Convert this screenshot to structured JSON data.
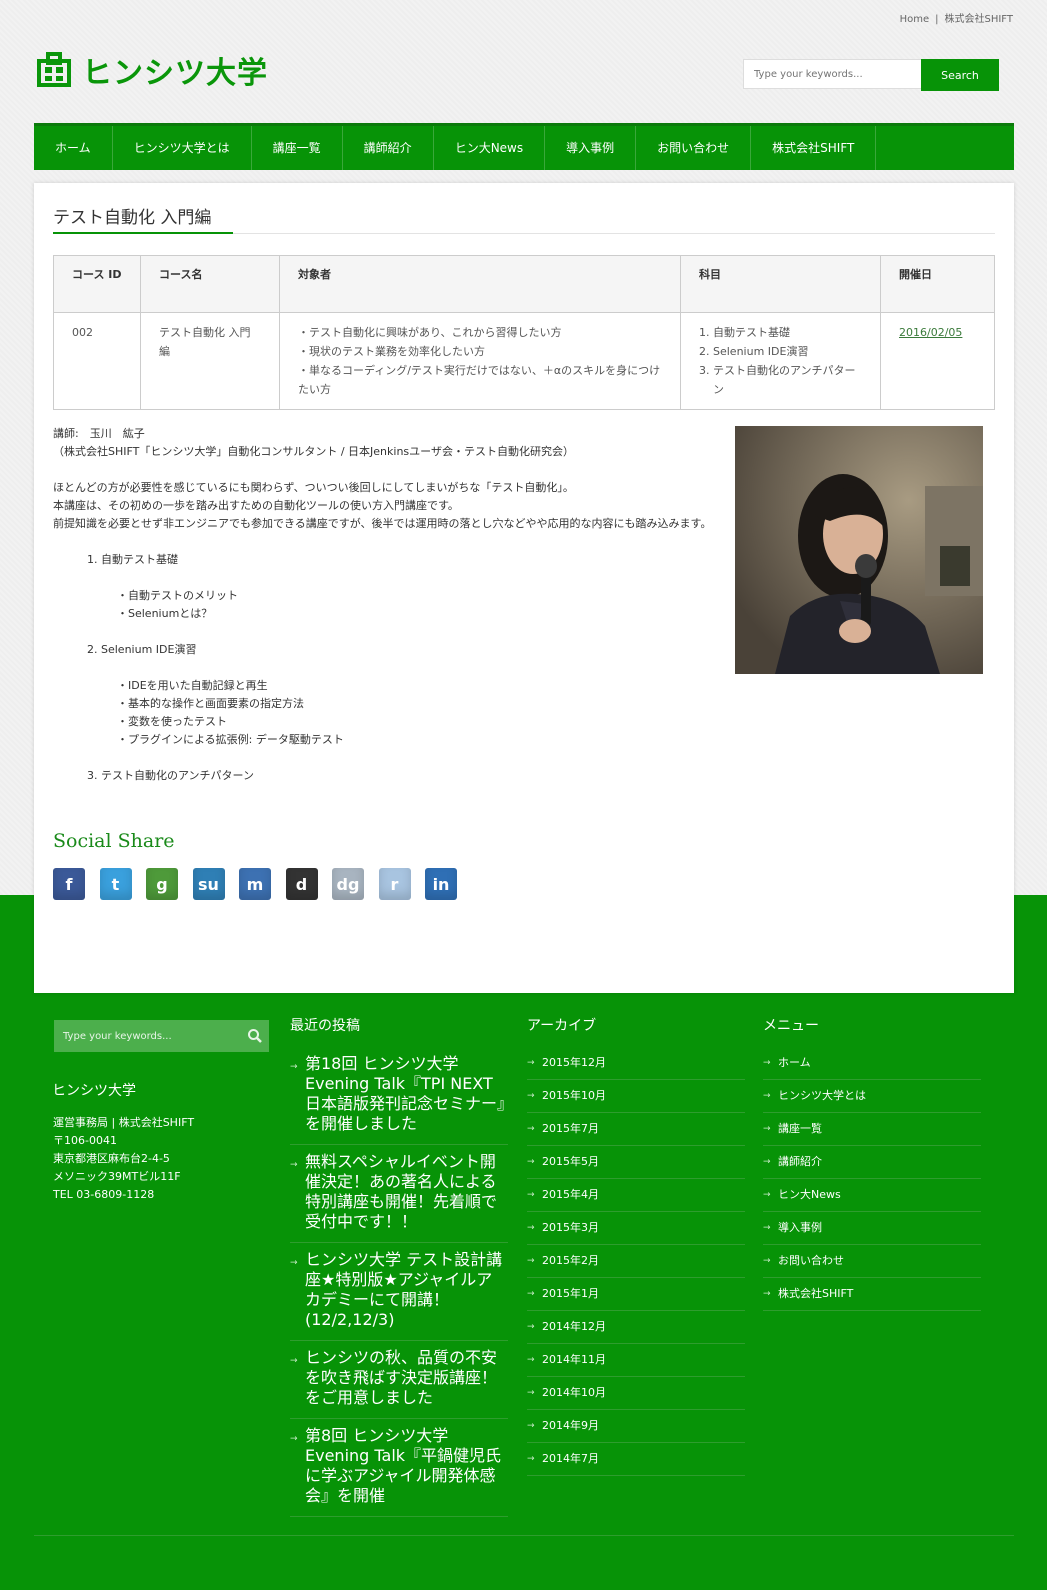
{
  "topbar": {
    "home": "Home",
    "sep": "|",
    "company": "株式会社SHIFT"
  },
  "site": {
    "title": "ヒンシツ大学",
    "brand_color": "#079307"
  },
  "search": {
    "placeholder": "Type your keywords...",
    "button": "Search"
  },
  "nav": [
    "ホーム",
    "ヒンシツ大学とは",
    "講座一覧",
    "講師紹介",
    "ヒン大News",
    "導入事例",
    "お問い合わせ",
    "株式会社SHIFT"
  ],
  "page": {
    "title": "テスト自動化 入門編"
  },
  "table": {
    "headers": [
      "コース ID",
      "コース名",
      "対象者",
      "科目",
      "開催日"
    ],
    "row": {
      "id": "002",
      "name": "テスト自動化 入門編",
      "target": [
        "・テスト自動化に興味があり、これから習得したい方",
        "・現状のテスト業務を効率化したい方",
        "・単なるコーディング/テスト実行だけではない、＋αのスキルを身につけたい方"
      ],
      "subjects": [
        "自動テスト基礎",
        "Selenium IDE演習",
        "テスト自動化のアンチパターン"
      ],
      "date": "2016/02/05"
    }
  },
  "body": {
    "lecturer": "講師:　玉川　紘子",
    "affiliation": "（株式会社SHIFT「ヒンシツ大学」自動化コンサルタント / 日本Jenkinsユーザ会・テスト自動化研究会）",
    "intro": [
      "ほとんどの方が必要性を感じているにも関わらず、ついつい後回しにしてしまいがちな「テスト自動化」。",
      "本講座は、その初めの一歩を踏み出すための自動化ツールの使い方入門講座です。",
      "前提知識を必要とせず非エンジニアでも参加できる講座ですが、後半では運用時の落とし穴などやや応用的な内容にも踏み込みます。"
    ],
    "outline": [
      {
        "title": "自動テスト基礎",
        "items": [
          "・自動テストのメリット",
          "・Seleniumとは？"
        ]
      },
      {
        "title": "Selenium IDE演習",
        "items": [
          "・IDEを用いた自動記録と再生",
          "・基本的な操作と画面要素の指定方法",
          "・変数を使ったテスト",
          "・プラグインによる拡張例: データ駆動テスト"
        ]
      },
      {
        "title": "テスト自動化のアンチパターン",
        "items": []
      }
    ]
  },
  "social": {
    "title": "Social Share",
    "icons": [
      {
        "name": "facebook-icon",
        "glyph": "f",
        "color": "#3b5998"
      },
      {
        "name": "twitter-icon",
        "glyph": "t",
        "color": "#3aa0dd"
      },
      {
        "name": "google-icon",
        "glyph": "g",
        "color": "#4e9a3a"
      },
      {
        "name": "stumbleupon-icon",
        "glyph": "su",
        "color": "#2f7fb5"
      },
      {
        "name": "myspace-icon",
        "glyph": "m",
        "color": "#3d71b2"
      },
      {
        "name": "delicious-icon",
        "glyph": "d",
        "color": "#333333"
      },
      {
        "name": "digg-icon",
        "glyph": "dg",
        "color": "#a8b4c0"
      },
      {
        "name": "reddit-icon",
        "glyph": "r",
        "color": "#a8c4e0"
      },
      {
        "name": "linkedin-icon",
        "glyph": "in",
        "color": "#2f6fb5"
      }
    ]
  },
  "footer": {
    "search_placeholder": "Type your keywords...",
    "site_name": "ヒンシツ大学",
    "address": [
      "運営事務局 | 株式会社SHIFT",
      "〒106-0041",
      "東京都港区麻布台2-4-5",
      "メソニック39MTビル11F",
      "TEL 03-6809-1128"
    ],
    "recent": {
      "title": "最近の投稿",
      "items": [
        "第18回 ヒンシツ大学 Evening Talk『TPI NEXT 日本語版発刊記念セミナー』を開催しました",
        "無料スペシャルイベント開催決定！あの著名人による特別講座も開催！先着順で受付中です！！",
        "ヒンシツ大学 テスト設計講座★特別版★アジャイルアカデミーにて開講！(12/2,12/3)",
        "ヒンシツの秋、品質の不安を吹き飛ばす決定版講座！をご用意しました",
        "第8回 ヒンシツ大学 Evening Talk『平鍋健児氏に学ぶアジャイル開発体感会』を開催"
      ]
    },
    "archive": {
      "title": "アーカイブ",
      "items": [
        "2015年12月",
        "2015年10月",
        "2015年7月",
        "2015年5月",
        "2015年4月",
        "2015年3月",
        "2015年2月",
        "2015年1月",
        "2014年12月",
        "2014年11月",
        "2014年10月",
        "2014年9月",
        "2014年7月"
      ]
    },
    "menu": {
      "title": "メニュー",
      "items": [
        "ホーム",
        "ヒンシツ大学とは",
        "講座一覧",
        "講師紹介",
        "ヒン大News",
        "導入事例",
        "お問い合わせ",
        "株式会社SHIFT"
      ]
    }
  }
}
